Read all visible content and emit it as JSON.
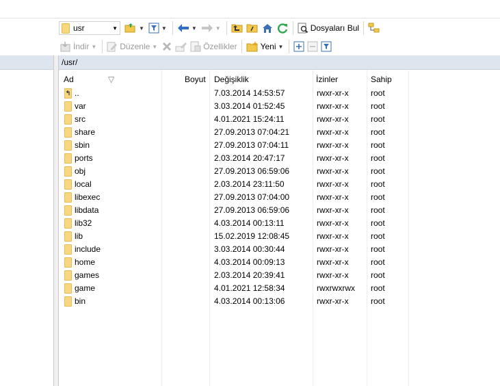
{
  "toolbar": {
    "path_combo_value": "usr",
    "find_files_label": "Dosyaları Bul",
    "download_label": "İndir",
    "edit_label": "Düzenle",
    "properties_label": "Özellikler",
    "new_label": "Yeni"
  },
  "path": "/usr/",
  "columns": {
    "name": "Ad",
    "size": "Boyut",
    "modified": "Değişiklik",
    "permissions": "İzinler",
    "owner": "Sahip"
  },
  "files": [
    {
      "name": "..",
      "modified": "7.03.2014 14:53:57",
      "permissions": "rwxr-xr-x",
      "owner": "root"
    },
    {
      "name": "var",
      "modified": "3.03.2014 01:52:45",
      "permissions": "rwxr-xr-x",
      "owner": "root"
    },
    {
      "name": "src",
      "modified": "4.01.2021 15:24:11",
      "permissions": "rwxr-xr-x",
      "owner": "root"
    },
    {
      "name": "share",
      "modified": "27.09.2013 07:04:21",
      "permissions": "rwxr-xr-x",
      "owner": "root"
    },
    {
      "name": "sbin",
      "modified": "27.09.2013 07:04:11",
      "permissions": "rwxr-xr-x",
      "owner": "root"
    },
    {
      "name": "ports",
      "modified": "2.03.2014 20:47:17",
      "permissions": "rwxr-xr-x",
      "owner": "root"
    },
    {
      "name": "obj",
      "modified": "27.09.2013 06:59:06",
      "permissions": "rwxr-xr-x",
      "owner": "root"
    },
    {
      "name": "local",
      "modified": "2.03.2014 23:11:50",
      "permissions": "rwxr-xr-x",
      "owner": "root"
    },
    {
      "name": "libexec",
      "modified": "27.09.2013 07:04:00",
      "permissions": "rwxr-xr-x",
      "owner": "root"
    },
    {
      "name": "libdata",
      "modified": "27.09.2013 06:59:06",
      "permissions": "rwxr-xr-x",
      "owner": "root"
    },
    {
      "name": "lib32",
      "modified": "4.03.2014 00:13:11",
      "permissions": "rwxr-xr-x",
      "owner": "root"
    },
    {
      "name": "lib",
      "modified": "15.02.2019 12:08:45",
      "permissions": "rwxr-xr-x",
      "owner": "root"
    },
    {
      "name": "include",
      "modified": "3.03.2014 00:30:44",
      "permissions": "rwxr-xr-x",
      "owner": "root"
    },
    {
      "name": "home",
      "modified": "4.03.2014 00:09:13",
      "permissions": "rwxr-xr-x",
      "owner": "root"
    },
    {
      "name": "games",
      "modified": "2.03.2014 20:39:41",
      "permissions": "rwxr-xr-x",
      "owner": "root"
    },
    {
      "name": "game",
      "modified": "4.01.2021 12:58:34",
      "permissions": "rwxrwxrwx",
      "owner": "root"
    },
    {
      "name": "bin",
      "modified": "4.03.2014 00:13:06",
      "permissions": "rwxr-xr-x",
      "owner": "root"
    }
  ]
}
